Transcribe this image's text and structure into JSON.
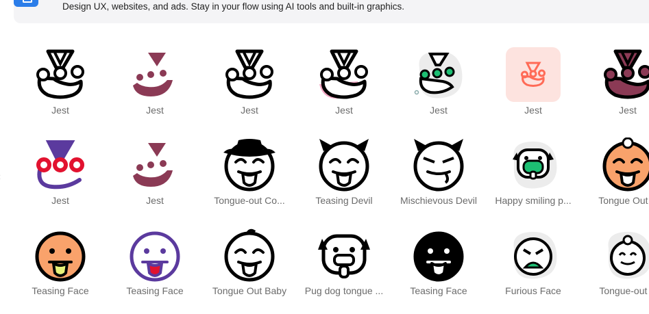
{
  "banner": {
    "text": "Design UX, websites, and ads. Stay in your flow using AI tools and built-in graphics.",
    "logo_icon": "app-logo-icon",
    "logo_color": "#2b7de9"
  },
  "icons": [
    {
      "label": "Jest",
      "icon": "jest-outline-icon"
    },
    {
      "label": "Jest",
      "icon": "jest-flat-maroon-icon"
    },
    {
      "label": "Jest",
      "icon": "jest-outline-icon"
    },
    {
      "label": "Jest",
      "icon": "jest-pink-icon"
    },
    {
      "label": "Jest",
      "icon": "jest-green-blob-icon"
    },
    {
      "label": "Jest",
      "icon": "jest-rounded-square-icon"
    },
    {
      "label": "Jest",
      "icon": "jest-filled-maroon-icon"
    },
    {
      "label": "Jest",
      "icon": "jest-purple-red-icon"
    },
    {
      "label": "Jest",
      "icon": "jest-flat-maroon-icon"
    },
    {
      "label": "Tongue-out Co...",
      "icon": "tongue-out-cowboy-icon"
    },
    {
      "label": "Teasing Devil",
      "icon": "teasing-devil-icon"
    },
    {
      "label": "Mischievous Devil",
      "icon": "mischievous-devil-icon"
    },
    {
      "label": "Happy smiling p...",
      "icon": "happy-smiling-pug-icon"
    },
    {
      "label": "Tongue Out B",
      "icon": "tongue-out-baby-orange-icon"
    },
    {
      "label": "Teasing Face",
      "icon": "teasing-face-orange-icon"
    },
    {
      "label": "Teasing Face",
      "icon": "teasing-face-purple-icon"
    },
    {
      "label": "Tongue Out Baby",
      "icon": "tongue-out-baby-icon"
    },
    {
      "label": "Pug dog tongue ...",
      "icon": "pug-dog-tongue-icon"
    },
    {
      "label": "Teasing Face",
      "icon": "teasing-face-black-icon"
    },
    {
      "label": "Furious Face",
      "icon": "furious-face-icon"
    },
    {
      "label": "Tongue-out B",
      "icon": "tongue-out-baby-blob-icon"
    }
  ],
  "colors": {
    "label": "#6b6b6b",
    "maroon": "#8b3a55",
    "pink": "#f2a7c3",
    "green": "#1dbf73",
    "coral": "#ff6b57",
    "purple": "#5b3a9e",
    "red": "#e2122f",
    "orange": "#f9a26b"
  }
}
